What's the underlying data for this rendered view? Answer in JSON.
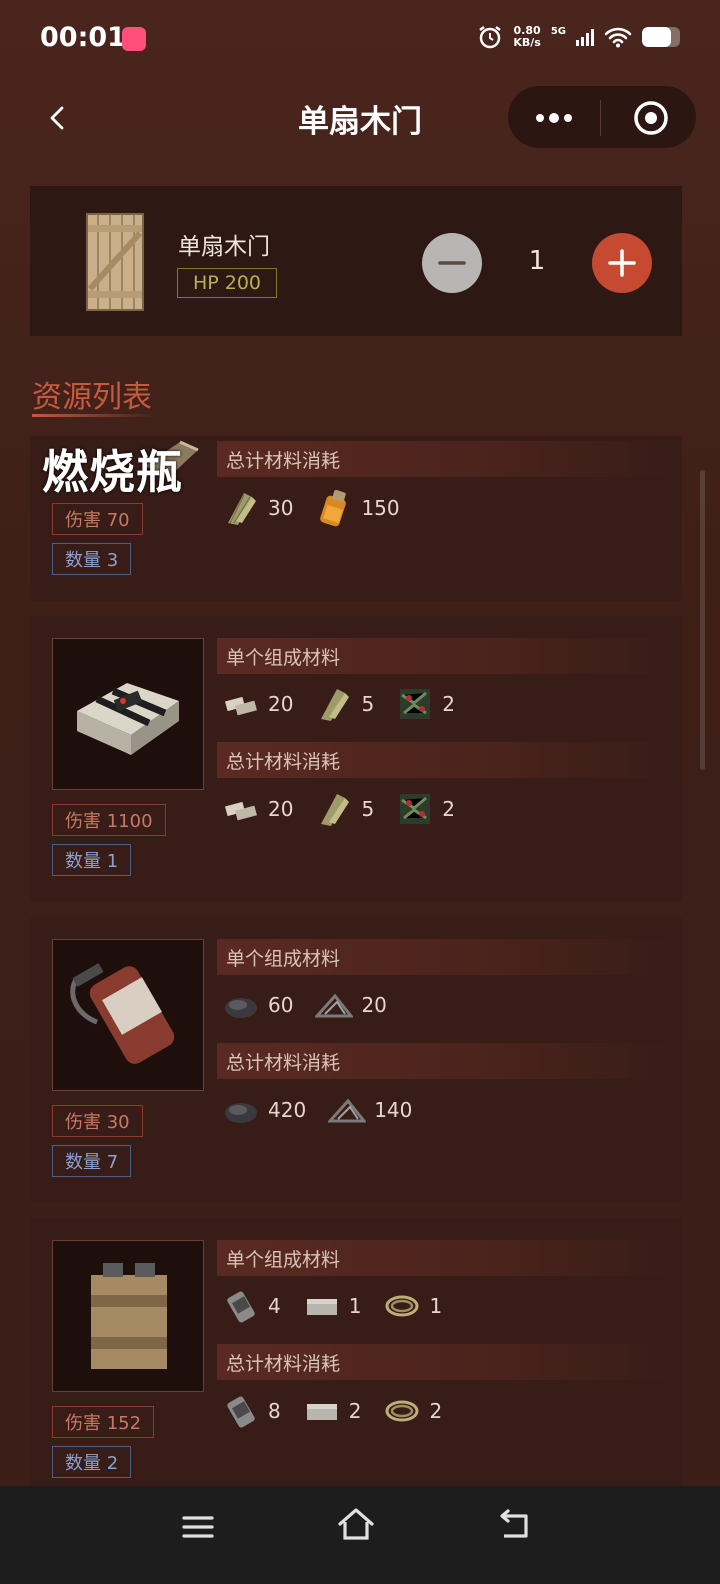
{
  "status_bar": {
    "time": "00:01",
    "net_speed_value": "0.80",
    "net_speed_unit": "KB/s",
    "network": "5G",
    "battery_level": 0.75
  },
  "header": {
    "title": "单扇木门"
  },
  "item": {
    "name": "单扇木门",
    "hp": "HP 200",
    "quantity": "1"
  },
  "section": {
    "title": "资源列表"
  },
  "overlay_label": "燃烧瓶",
  "labels": {
    "single": "单个组成材料",
    "total": "总计材料消耗"
  },
  "resources": [
    {
      "damage": "伤害 70",
      "count": "数量 3",
      "total": [
        {
          "icon": "cloth-icon",
          "value": "30"
        },
        {
          "icon": "low-grade-fuel-icon",
          "value": "150"
        }
      ]
    },
    {
      "damage": "伤害 1100",
      "count": "数量 1",
      "single": [
        {
          "icon": "explosives-icon",
          "value": "20"
        },
        {
          "icon": "cloth-icon",
          "value": "5"
        },
        {
          "icon": "tech-trash-icon",
          "value": "2"
        }
      ],
      "total": [
        {
          "icon": "explosives-icon",
          "value": "20"
        },
        {
          "icon": "cloth-icon",
          "value": "5"
        },
        {
          "icon": "tech-trash-icon",
          "value": "2"
        }
      ]
    },
    {
      "damage": "伤害 30",
      "count": "数量 7",
      "single": [
        {
          "icon": "gunpowder-icon",
          "value": "60"
        },
        {
          "icon": "metal-fragments-icon",
          "value": "20"
        }
      ],
      "total": [
        {
          "icon": "gunpowder-icon",
          "value": "420"
        },
        {
          "icon": "metal-fragments-icon",
          "value": "140"
        }
      ]
    },
    {
      "damage": "伤害 152",
      "count": "数量 2",
      "single": [
        {
          "icon": "beancan-grenade-icon",
          "value": "4"
        },
        {
          "icon": "metal-box-icon",
          "value": "1"
        },
        {
          "icon": "rope-icon",
          "value": "1"
        }
      ],
      "total": [
        {
          "icon": "beancan-grenade-icon",
          "value": "8"
        },
        {
          "icon": "metal-box-icon",
          "value": "2"
        },
        {
          "icon": "rope-icon",
          "value": "2"
        }
      ]
    }
  ]
}
